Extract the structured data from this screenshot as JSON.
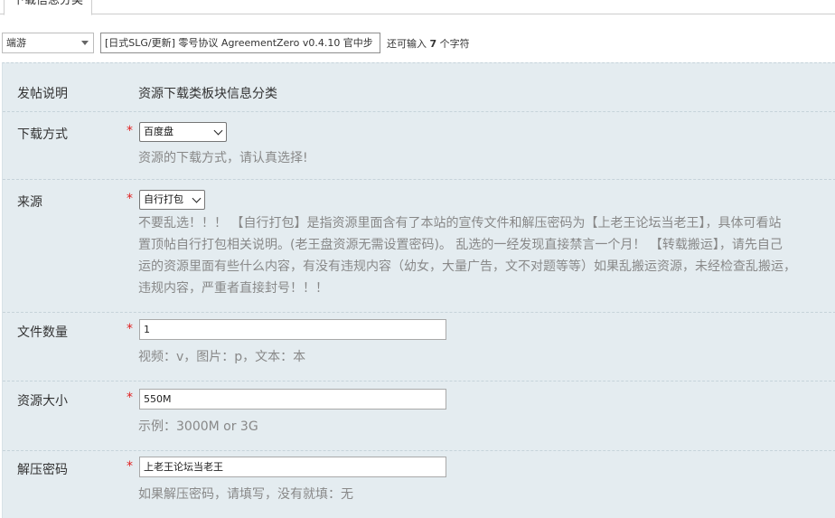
{
  "tabs": [
    {
      "label": "下载信息分类"
    }
  ],
  "subject": {
    "type_selected": "端游",
    "title_value": "[日式SLG/更新] 零号协议 AgreementZero v0.4.10 官中步",
    "remaining_prefix": "还可输入",
    "remaining_count": "7",
    "remaining_suffix": "个字符"
  },
  "form": {
    "intro": {
      "label": "发帖说明",
      "value": "资源下载类板块信息分类"
    },
    "download_method": {
      "label": "下载方式",
      "required_mark": "*",
      "selected": "百度盘",
      "hint": "资源的下载方式，请认真选择!"
    },
    "source": {
      "label": "来源",
      "required_mark": "*",
      "selected": "自行打包",
      "description_lines": [
        "不要乱选！！！ 【自行打包】是指资源里面含有了本站的宣传文件和解压密码为【上老王论坛当老王】，具体可看站",
        "置顶帖自行打包相关说明。(老王盘资源无需设置密码)。 乱选的一经发现直接禁言一个月！ 【转载搬运】，请先自己",
        "运的资源里面有些什么内容，有没有违规内容（幼女，大量广告，文不对题等等）如果乱搬运资源，未经检查乱搬运，",
        "违规内容，严重者直接封号！！！"
      ]
    },
    "file_count": {
      "label": "文件数量",
      "required_mark": "*",
      "value": "1",
      "hint": "视频：v，图片：p，文本：本"
    },
    "size": {
      "label": "资源大小",
      "required_mark": "*",
      "value": "550M",
      "hint": "示例：3000M or 3G"
    },
    "password": {
      "label": "解压密码",
      "required_mark": "*",
      "value": "上老王论坛当老王",
      "hint": "如果解压密码，请填写，没有就填：无"
    }
  },
  "colors": {
    "panel_bg": "#e4ecf0",
    "required": "#e02020",
    "hint_text": "#888888"
  }
}
